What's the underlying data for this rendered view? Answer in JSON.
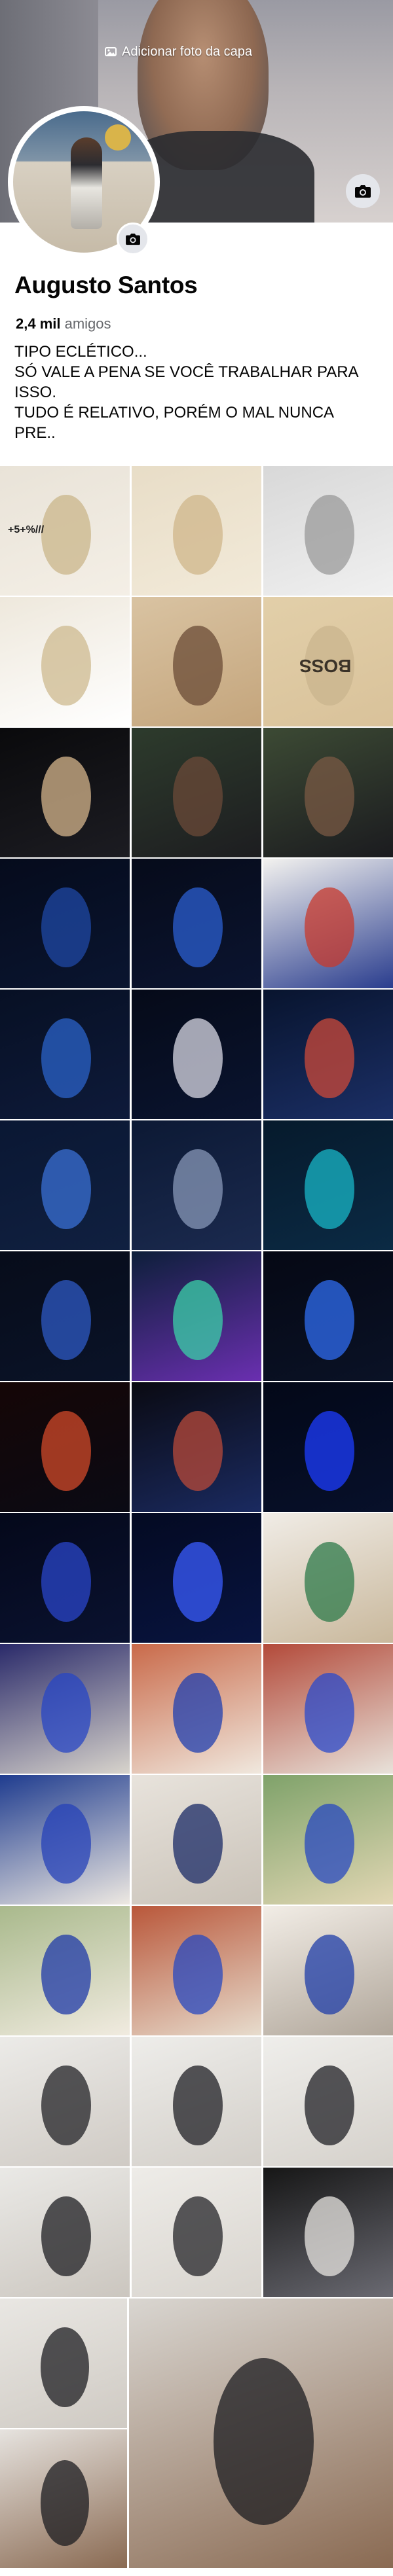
{
  "cover": {
    "add_cover_label": "Adicionar foto da capa",
    "add_cover_icon": "photo-icon",
    "camera_icon": "camera-icon"
  },
  "profile": {
    "name": "Augusto Santos",
    "friends_count": "2,4 mil",
    "friends_label": "amigos",
    "bio": "TIPO ECLÉTICO...\nSÓ VALE A PENA SE VOCÊ TRABALHAR PARA ISSO.\nTUDO É RELATIVO, PORÉM O MAL NUNCA PRE..",
    "avatar_camera_icon": "camera-icon"
  },
  "colors": {
    "name_text": "#050505",
    "secondary_text": "#65676b",
    "camera_button_bg": "#e4e6eb"
  },
  "photos": [
    {
      "label": "",
      "colors": [
        "#e9e3d8",
        "#c9b58a",
        "#f4efe6"
      ],
      "caption": "+5+%///"
    },
    {
      "label": "",
      "colors": [
        "#e8ddc7",
        "#cfb58a",
        "#f2ead9"
      ]
    },
    {
      "label": "",
      "colors": [
        "#d8d8d8",
        "#9a9a9a",
        "#f0f0f0"
      ]
    },
    {
      "label": "",
      "colors": [
        "#eee8dc",
        "#cdb98f",
        "#ffffff"
      ]
    },
    {
      "label": "",
      "colors": [
        "#d9c3a2",
        "#6a4b36",
        "#c4a57c"
      ]
    },
    {
      "label": "",
      "colors": [
        "#e2cfa9",
        "#c9b48e",
        "#d9c29a"
      ],
      "caption": "BOSS"
    },
    {
      "label": "",
      "colors": [
        "#0a0a0c",
        "#d5b58c",
        "#1c1c22"
      ]
    },
    {
      "label": "",
      "colors": [
        "#2d3b2c",
        "#6b4a38",
        "#1d1d20"
      ]
    },
    {
      "label": "",
      "colors": [
        "#3c4a34",
        "#7a5a44",
        "#1b1b1f"
      ]
    },
    {
      "label": "",
      "colors": [
        "#050b1c",
        "#1f48a6",
        "#0a1530"
      ]
    },
    {
      "label": "",
      "colors": [
        "#060b1a",
        "#2b5fd1",
        "#0b1430"
      ]
    },
    {
      "label": "",
      "colors": [
        "#f3f2ef",
        "#c83a2c",
        "#2a3d8e"
      ]
    },
    {
      "label": "",
      "colors": [
        "#071024",
        "#2b63c9",
        "#0e1a3a"
      ]
    },
    {
      "label": "",
      "colors": [
        "#050a18",
        "#d9d9e5",
        "#0a1430"
      ]
    },
    {
      "label": "",
      "colors": [
        "#08142e",
        "#cc4a3a",
        "#1b2f66"
      ]
    },
    {
      "label": "",
      "colors": [
        "#0a1733",
        "#3a70d6",
        "#102040"
      ]
    },
    {
      "label": "",
      "colors": [
        "#0c1934",
        "#8898b8",
        "#1b2a4f"
      ]
    },
    {
      "label": "",
      "colors": [
        "#061a2c",
        "#18b7c8",
        "#0b2a44"
      ]
    },
    {
      "label": "",
      "colors": [
        "#070c1a",
        "#2d5ac4",
        "#0a1328"
      ]
    },
    {
      "label": "",
      "colors": [
        "#0d1f3a",
        "#3bd1a8",
        "#6a2fb0"
      ]
    },
    {
      "label": "",
      "colors": [
        "#050814",
        "#2f6cf0",
        "#0a1226"
      ]
    },
    {
      "label": "",
      "colors": [
        "#150606",
        "#d24a2a",
        "#0a0a14"
      ]
    },
    {
      "label": "",
      "colors": [
        "#0a0a12",
        "#b84a3a",
        "#1a2a60"
      ]
    },
    {
      "label": "",
      "colors": [
        "#030818",
        "#1c3cff",
        "#07102a"
      ]
    },
    {
      "label": "",
      "colors": [
        "#04081a",
        "#2a46c9",
        "#0a1230"
      ]
    },
    {
      "label": "",
      "colors": [
        "#040a22",
        "#3a5cff",
        "#081440"
      ]
    },
    {
      "label": "",
      "colors": [
        "#f0ece6",
        "#2e7a4a",
        "#c9b89c"
      ]
    },
    {
      "label": "",
      "colors": [
        "#2a2a6a",
        "#2746c4",
        "#d8d4cc"
      ]
    },
    {
      "label": "",
      "colors": [
        "#c96a4a",
        "#1f3fb0",
        "#f0e8de"
      ]
    },
    {
      "label": "",
      "colors": [
        "#b34a3a",
        "#2a4acb",
        "#e8e2da"
      ]
    },
    {
      "label": "",
      "colors": [
        "#1f3c8f",
        "#2542b8",
        "#eee9e2"
      ]
    },
    {
      "label": "",
      "colors": [
        "#e8e3dc",
        "#1a2a66",
        "#c9c2b8"
      ]
    },
    {
      "label": "",
      "colors": [
        "#7fa26a",
        "#2748c0",
        "#e2d7b4"
      ]
    },
    {
      "label": "",
      "colors": [
        "#a9b98c",
        "#1f3aa8",
        "#f1ebe0"
      ]
    },
    {
      "label": "",
      "colors": [
        "#b9573a",
        "#2748c0",
        "#e7dccd"
      ]
    },
    {
      "label": "",
      "colors": [
        "#f2ede6",
        "#1f3da8",
        "#b0a69a"
      ]
    },
    {
      "label": "",
      "colors": [
        "#ecebe8",
        "#222226",
        "#cfcac4"
      ]
    },
    {
      "label": "",
      "colors": [
        "#eeedea",
        "#1f1f24",
        "#d2cec8"
      ]
    },
    {
      "label": "",
      "colors": [
        "#efeeeb",
        "#202026",
        "#d5d1cb"
      ]
    },
    {
      "label": "",
      "colors": [
        "#eae9e6",
        "#1d1d22",
        "#cbc6bf"
      ]
    },
    {
      "label": "",
      "colors": [
        "#eeece8",
        "#242428",
        "#d8d4ce"
      ]
    },
    {
      "label": "",
      "colors": [
        "#161616",
        "#e8e6e2",
        "#6a6a72"
      ]
    },
    {
      "label": "",
      "colors": [
        "#e9e7e3",
        "#1d1d22",
        "#cfcac3"
      ]
    },
    {
      "label": "",
      "colors": [
        "#d9d6d1",
        "#1c1c20",
        "#8a6a52"
      ]
    },
    {
      "label": "",
      "colors": [
        "#e6e3df",
        "#1c1c20",
        "#8a6a52"
      ]
    }
  ]
}
